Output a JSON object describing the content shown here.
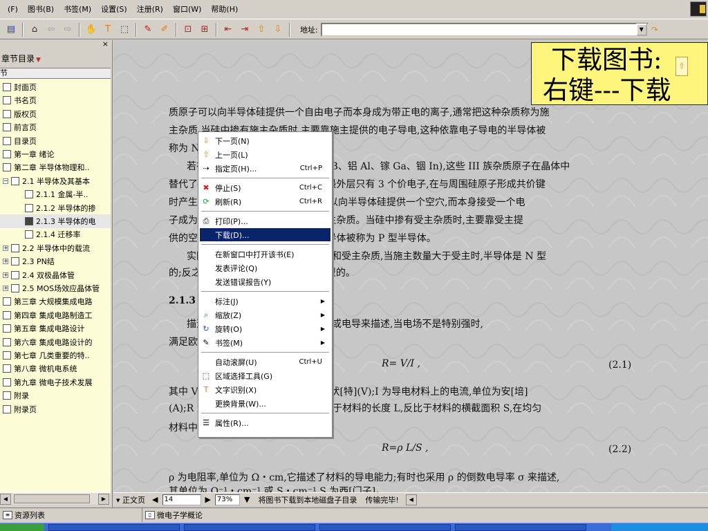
{
  "menubar": {
    "items": [
      "(F)",
      "图书(B)",
      "书签(M)",
      "设置(S)",
      "注册(R)",
      "窗口(W)",
      "帮助(H)"
    ]
  },
  "toolbar": {
    "address_label": "地址:",
    "address_value": "",
    "icons": [
      "panel-icon",
      "home-icon",
      "back-icon",
      "forward-icon",
      "hand-icon",
      "text-select-icon",
      "region-select-icon",
      "bookmark-icon",
      "annotate-icon",
      "fit-page-icon",
      "fit-width-icon",
      "first-page-icon",
      "last-page-icon",
      "page-up-icon",
      "page-down-icon"
    ]
  },
  "sidebar": {
    "close": "×",
    "title": "章节目录",
    "subheader": "节",
    "items": [
      {
        "label": "封面页",
        "level": 0,
        "expander": "",
        "style": "normal"
      },
      {
        "label": "书名页",
        "level": 0,
        "expander": "",
        "style": "normal"
      },
      {
        "label": "版权页",
        "level": 0,
        "expander": "",
        "style": "normal"
      },
      {
        "label": "前言页",
        "level": 0,
        "expander": "",
        "style": "normal"
      },
      {
        "label": "目录页",
        "level": 0,
        "expander": "",
        "style": "normal"
      },
      {
        "label": "第一章 绪论",
        "level": 0,
        "expander": "",
        "style": "normal"
      },
      {
        "label": "第二章 半导体物理和..",
        "level": 0,
        "expander": "",
        "style": "normal"
      },
      {
        "label": "2.1 半导体及其基本",
        "level": 1,
        "expander": "−",
        "style": "normal"
      },
      {
        "label": "2.1.1 金属-半..",
        "level": 2,
        "expander": "",
        "style": "normal"
      },
      {
        "label": "2.1.2 半导体的掺",
        "level": 2,
        "expander": "",
        "style": "normal"
      },
      {
        "label": "2.1.3 半导体的电",
        "level": 2,
        "expander": "",
        "style": "current"
      },
      {
        "label": "2.1.4 迁移率",
        "level": 2,
        "expander": "",
        "style": "normal"
      },
      {
        "label": "2.2 半导体中的载流",
        "level": 1,
        "expander": "+",
        "style": "normal"
      },
      {
        "label": "2.3 PN结",
        "level": 1,
        "expander": "+",
        "style": "normal"
      },
      {
        "label": "2.4 双极晶体管",
        "level": 1,
        "expander": "+",
        "style": "normal"
      },
      {
        "label": "2.5 MOS场效应晶体管",
        "level": 1,
        "expander": "+",
        "style": "normal"
      },
      {
        "label": "第三章 大规模集成电路",
        "level": 0,
        "expander": "",
        "style": "normal"
      },
      {
        "label": "第四章 集成电路制造工",
        "level": 0,
        "expander": "",
        "style": "normal"
      },
      {
        "label": "第五章 集成电路设计",
        "level": 0,
        "expander": "",
        "style": "normal"
      },
      {
        "label": "第六章 集成电路设计的",
        "level": 0,
        "expander": "",
        "style": "normal"
      },
      {
        "label": "第七章 几类重要的特..",
        "level": 0,
        "expander": "",
        "style": "normal"
      },
      {
        "label": "第八章 微机电系统",
        "level": 0,
        "expander": "",
        "style": "normal"
      },
      {
        "label": "第九章 微电子技术发展",
        "level": 0,
        "expander": "",
        "style": "normal"
      },
      {
        "label": "附录",
        "level": 0,
        "expander": "",
        "style": "normal"
      },
      {
        "label": "附录页",
        "level": 0,
        "expander": "",
        "style": "normal"
      }
    ]
  },
  "overlay": {
    "line1": "下载图书:",
    "line2": "右键---下载"
  },
  "document": {
    "lines": [
      "质原子可以向半导体硅提供一个自由电子而本身成为带正电的离子,通常把这种杂质称为施",
      "主杂质,当硅中掺有施主杂质时,主要靠施主提供的电子导电,这种依靠电子导电的半导体被",
      "称为 N 型半导体。",
      "若在硅中掺入III族元素杂质(如硼 B、铝 Al、镓 Ga、铟 In),这些 III 族杂质原子在晶体中",
      "替代了部分硅原子的位置,由于它们的最外层只有 3 个价电子,在与周围硅原子形成共价键",
      "时产生一个空位,这样III族杂质原子可以向半导体硅提供一个空穴,而本身接受一个电",
      "子成为带负电的离子,这种杂质称为受主杂质。当硅中掺有受主杂质时,主要靠受主提",
      "供的空穴导电,这种依靠空穴导电的半导体被称为 P 型半导体。",
      "实际的半导体中往往同时含有施主和受主杂质,当施主数量大于受主时,半导体是 N 型",
      "的;反之,受主数量大于施主时,则是 P 型的。",
      "2.1.3 半导体的电导率和电阻率",
      "描述半导体导电能力通常采用电阻或电导来描述,当电场不是特别强时,",
      "满足欧姆定律",
      "R= V/I ,",
      "其中 V 为加在导体两端的电压,单位为伏[特](V);I 为导电材料上的电流,单位为安[培]",
      "(A);R 为电阻,单位为欧[姆](Ω),它正比于材料的长度 L,反比于材料的横截面积 S,在均匀",
      "材料中",
      "R=ρ L/S ,",
      "ρ 为电阻率,单位为 Ω・cm,它描述了材料的导电能力;有时也采用 ρ 的倒数电导率 σ 来描述,",
      "其单位为 Ω⁻¹・cm⁻¹ 或 S・cm⁻¹,S 为西[门子]。"
    ],
    "eq1_num": "(2.1)",
    "eq2_num": "(2.2)"
  },
  "context_menu": {
    "items": [
      {
        "label": "下一页(N)",
        "shortcut": "",
        "icon": "down-arrow-icon",
        "submenu": false
      },
      {
        "label": "上一页(L)",
        "shortcut": "",
        "icon": "up-arrow-icon",
        "submenu": false
      },
      {
        "label": "指定页(H)...",
        "shortcut": "Ctrl+P",
        "icon": "goto-page-icon",
        "submenu": false
      },
      {
        "label": "停止(S)",
        "shortcut": "Ctrl+C",
        "icon": "stop-icon",
        "submenu": false
      },
      {
        "label": "刷新(R)",
        "shortcut": "Ctrl+R",
        "icon": "refresh-icon",
        "submenu": false
      },
      {
        "label": "打印(P)...",
        "shortcut": "",
        "icon": "print-icon",
        "submenu": false
      },
      {
        "label": "下载(D)...",
        "shortcut": "",
        "icon": "",
        "submenu": false
      },
      {
        "label": "在新窗口中打开该书(E)",
        "shortcut": "",
        "icon": "",
        "submenu": false
      },
      {
        "label": "发表评论(Q)",
        "shortcut": "",
        "icon": "",
        "submenu": false
      },
      {
        "label": "发送错误报告(Y)",
        "shortcut": "",
        "icon": "",
        "submenu": false
      },
      {
        "label": "标注(J)",
        "shortcut": "",
        "icon": "",
        "submenu": true
      },
      {
        "label": "缩放(Z)",
        "shortcut": "",
        "icon": "zoom-icon",
        "submenu": true
      },
      {
        "label": "旋转(O)",
        "shortcut": "",
        "icon": "rotate-icon",
        "submenu": true
      },
      {
        "label": "书签(M)",
        "shortcut": "",
        "icon": "bookmark-icon",
        "submenu": true
      },
      {
        "label": "自动滚屏(U)",
        "shortcut": "Ctrl+U",
        "icon": "",
        "submenu": false
      },
      {
        "label": "区域选择工具(G)",
        "shortcut": "",
        "icon": "region-select-icon",
        "submenu": false
      },
      {
        "label": "文字识别(X)",
        "shortcut": "",
        "icon": "ocr-icon",
        "submenu": false
      },
      {
        "label": "更换背景(W)...",
        "shortcut": "",
        "icon": "",
        "submenu": false
      },
      {
        "label": "属性(R)...",
        "shortcut": "",
        "icon": "properties-icon",
        "submenu": false
      }
    ],
    "highlighted_index": 6
  },
  "statusbar": {
    "page_type": "正文页",
    "page_number": "14",
    "zoom": "73%",
    "message": "将图书下载到本地磁盘子目录",
    "transfer_status": "传输完毕!"
  },
  "bottom_tabs": {
    "resources": "资源列表",
    "book": "微电子学概论"
  },
  "colors": {
    "chrome": "#d4d0c8",
    "tree_bg": "#fcfdd6",
    "overlay_bg": "#fdf57c",
    "menu_highlight": "#0a246a"
  }
}
